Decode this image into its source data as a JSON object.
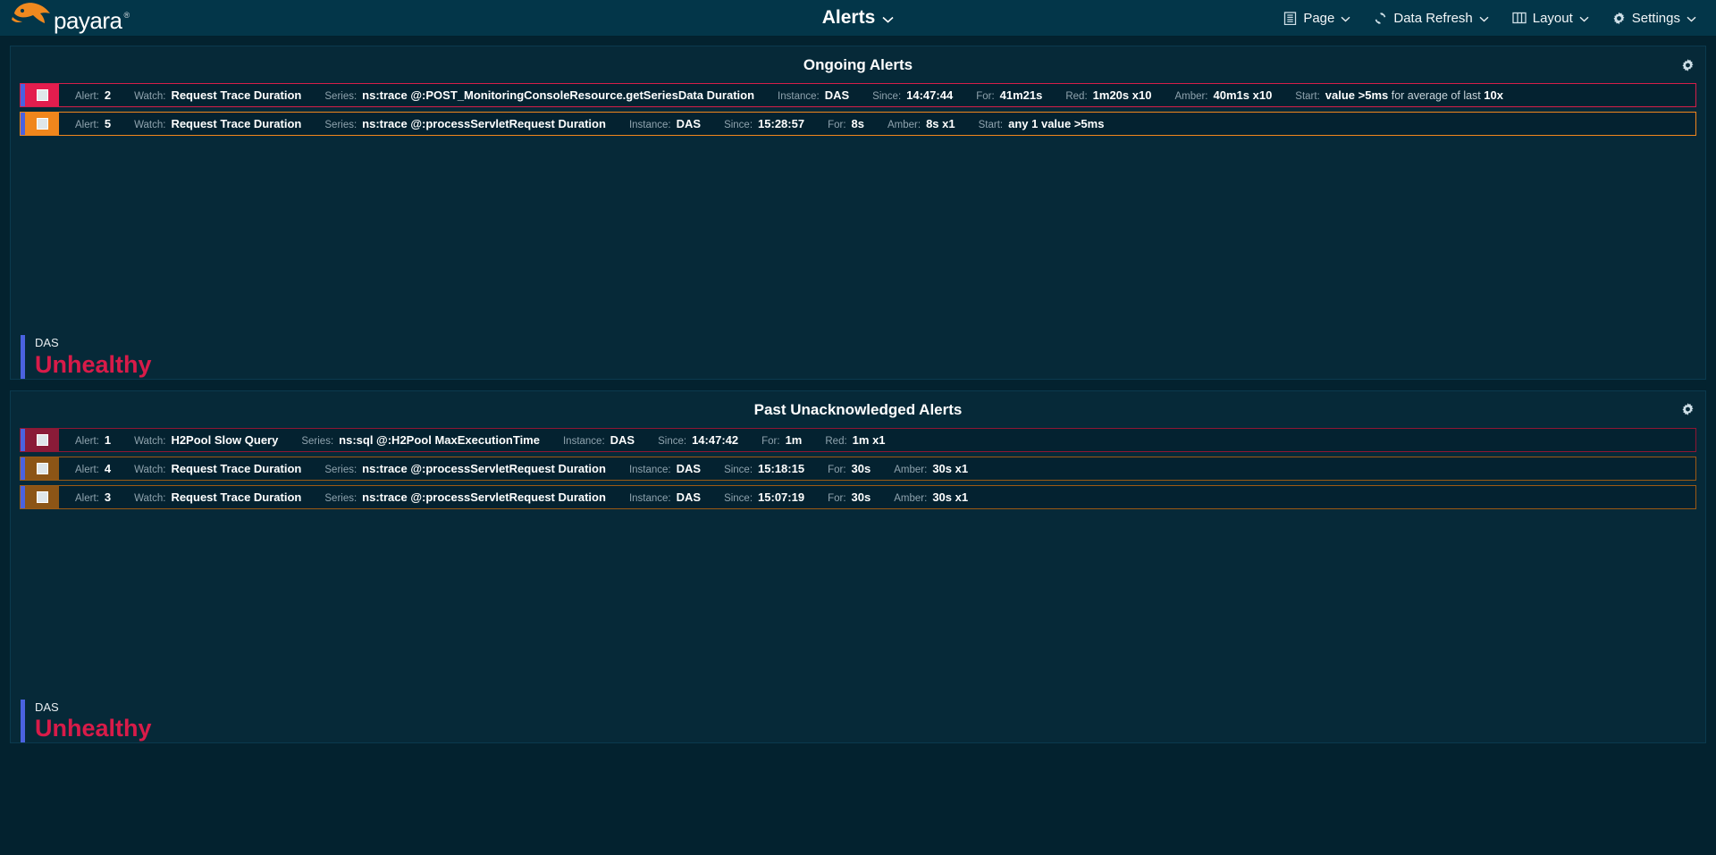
{
  "brand": {
    "name": "payara",
    "registered": "®",
    "icon": "fish-logo-icon"
  },
  "header": {
    "title": "Alerts",
    "title_chevron": "⌄",
    "nav": [
      {
        "label": "Page",
        "icon": "page-list-icon",
        "chevron": "⌄"
      },
      {
        "label": "Data Refresh",
        "icon": "refresh-sync-icon",
        "chevron": "⌄"
      },
      {
        "label": "Layout",
        "icon": "layout-columns-icon",
        "chevron": "⌄"
      },
      {
        "label": "Settings",
        "icon": "gear-icon",
        "chevron": "⌄"
      }
    ]
  },
  "panels": [
    {
      "title": "Ongoing Alerts",
      "gear_icon": "gear-icon",
      "alerts": [
        {
          "severity": "red",
          "fields": [
            {
              "label": "Alert:",
              "value": "2"
            },
            {
              "label": "Watch:",
              "value": "Request Trace Duration"
            },
            {
              "label": "Series:",
              "value": "ns:trace @:POST_MonitoringConsoleResource.getSeriesData Duration"
            },
            {
              "label": "Instance:",
              "value": "DAS"
            },
            {
              "label": "Since:",
              "value": "14:47:44"
            },
            {
              "label": "For:",
              "value": "41m21s"
            },
            {
              "label": "Red:",
              "value": "1m20s x10"
            },
            {
              "label": "Amber:",
              "value": "40m1s x10"
            },
            {
              "label": "Start:",
              "value": "value >5ms",
              "suffix": " for average of last ",
              "suffix_value": "10x"
            }
          ]
        },
        {
          "severity": "amber",
          "fields": [
            {
              "label": "Alert:",
              "value": "5"
            },
            {
              "label": "Watch:",
              "value": "Request Trace Duration"
            },
            {
              "label": "Series:",
              "value": "ns:trace @:processServletRequest Duration"
            },
            {
              "label": "Instance:",
              "value": "DAS"
            },
            {
              "label": "Since:",
              "value": "15:28:57"
            },
            {
              "label": "For:",
              "value": "8s"
            },
            {
              "label": "Amber:",
              "value": "8s x1"
            },
            {
              "label": "Start:",
              "value": "any 1 value >5ms"
            }
          ]
        }
      ],
      "status": {
        "name": "DAS",
        "value": "Unhealthy"
      }
    },
    {
      "title": "Past Unacknowledged Alerts",
      "gear_icon": "gear-icon",
      "alerts": [
        {
          "severity": "darkred",
          "fields": [
            {
              "label": "Alert:",
              "value": "1"
            },
            {
              "label": "Watch:",
              "value": "H2Pool Slow Query"
            },
            {
              "label": "Series:",
              "value": "ns:sql @:H2Pool MaxExecutionTime"
            },
            {
              "label": "Instance:",
              "value": "DAS"
            },
            {
              "label": "Since:",
              "value": "14:47:42"
            },
            {
              "label": "For:",
              "value": "1m"
            },
            {
              "label": "Red:",
              "value": "1m x1"
            }
          ]
        },
        {
          "severity": "darkamber",
          "fields": [
            {
              "label": "Alert:",
              "value": "4"
            },
            {
              "label": "Watch:",
              "value": "Request Trace Duration"
            },
            {
              "label": "Series:",
              "value": "ns:trace @:processServletRequest Duration"
            },
            {
              "label": "Instance:",
              "value": "DAS"
            },
            {
              "label": "Since:",
              "value": "15:18:15"
            },
            {
              "label": "For:",
              "value": "30s"
            },
            {
              "label": "Amber:",
              "value": "30s x1"
            }
          ]
        },
        {
          "severity": "darkamber",
          "fields": [
            {
              "label": "Alert:",
              "value": "3"
            },
            {
              "label": "Watch:",
              "value": "Request Trace Duration"
            },
            {
              "label": "Series:",
              "value": "ns:trace @:processServletRequest Duration"
            },
            {
              "label": "Instance:",
              "value": "DAS"
            },
            {
              "label": "Since:",
              "value": "15:07:19"
            },
            {
              "label": "For:",
              "value": "30s"
            },
            {
              "label": "Amber:",
              "value": "30s x1"
            }
          ]
        }
      ],
      "status": {
        "name": "DAS",
        "value": "Unhealthy"
      }
    }
  ],
  "colors": {
    "background": "#03222f",
    "topbar": "#033649",
    "panel": "#062938",
    "accent_blue": "#4a62e0",
    "severity_red": "#e31d4e",
    "severity_amber": "#f0861c",
    "unhealthy": "#d81b49",
    "brand_orange": "#f0891f"
  }
}
